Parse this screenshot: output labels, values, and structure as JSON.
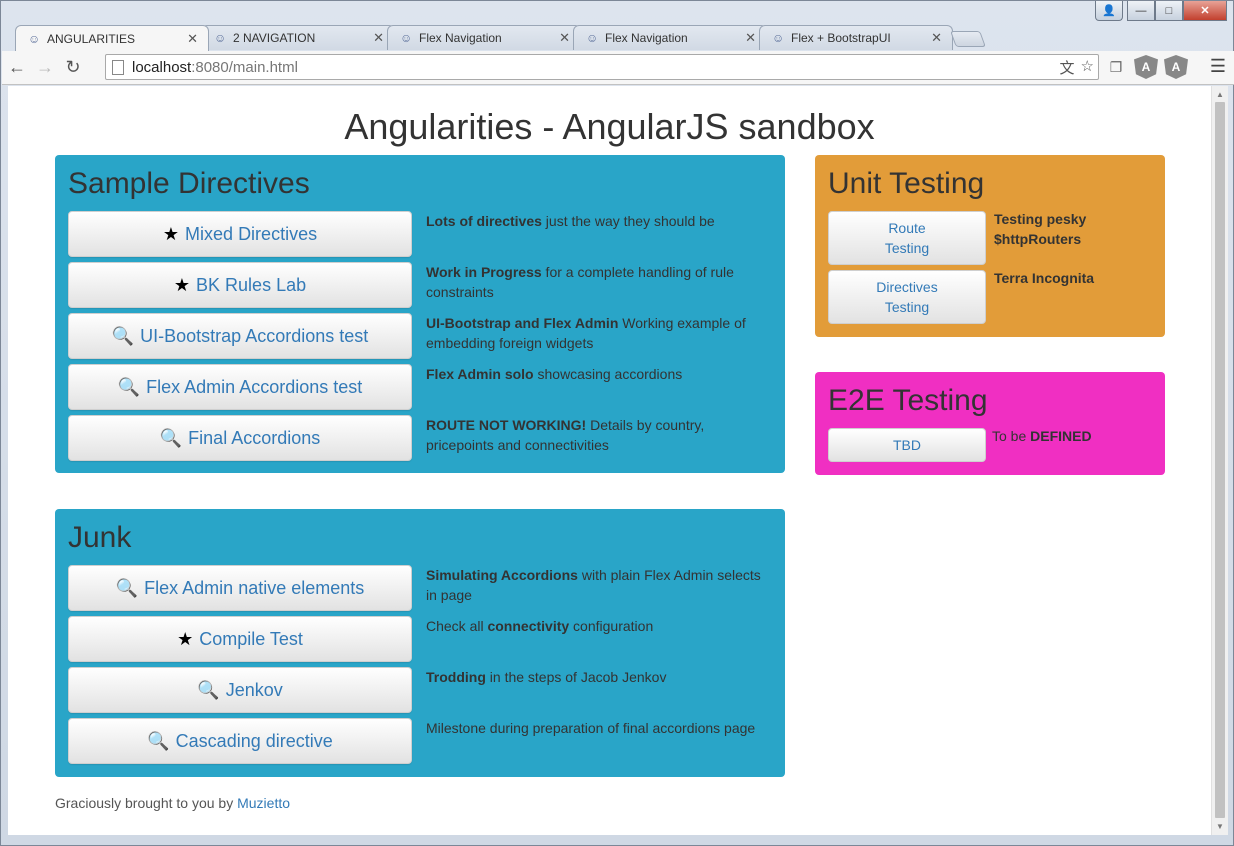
{
  "browser": {
    "tabs": [
      {
        "label": "ANGULARITIES",
        "active": true
      },
      {
        "label": "2 NAVIGATION",
        "active": false
      },
      {
        "label": "Flex Navigation",
        "active": false
      },
      {
        "label": "Flex Navigation",
        "active": false
      },
      {
        "label": "Flex + BootstrapUI",
        "active": false
      }
    ],
    "url_host": "localhost",
    "url_path": ":8080/main.html"
  },
  "page": {
    "title": "Angularities - AngularJS sandbox",
    "sample_directives": {
      "heading": "Sample Directives",
      "items": [
        {
          "icon": "star-icon",
          "label": "Mixed Directives",
          "desc_bold": "Lots of directives",
          "desc_rest": " just the way they should be"
        },
        {
          "icon": "star-icon",
          "label": "BK Rules Lab",
          "desc_bold": "Work in Progress",
          "desc_rest": " for a complete handling of rule constraints"
        },
        {
          "icon": "zoom-icon",
          "label": "UI-Bootstrap Accordions test",
          "desc_bold": "UI-Bootstrap and Flex Admin",
          "desc_rest": " Working example of embedding foreign widgets"
        },
        {
          "icon": "zoom-icon",
          "label": "Flex Admin Accordions test",
          "desc_bold": "Flex Admin solo",
          "desc_rest": " showcasing accordions"
        },
        {
          "icon": "zoom-icon",
          "label": "Final Accordions",
          "desc_bold": "ROUTE NOT WORKING!",
          "desc_rest": " Details by country, pricepoints and connectivities"
        }
      ]
    },
    "junk": {
      "heading": "Junk",
      "items": [
        {
          "icon": "zoom-icon",
          "label": "Flex Admin native elements",
          "desc_pre": "",
          "desc_bold": "Simulating Accordions",
          "desc_rest": " with plain Flex Admin selects in page"
        },
        {
          "icon": "star-icon",
          "label": "Compile Test",
          "desc_pre": "Check all ",
          "desc_bold": "connectivity",
          "desc_rest": " configuration"
        },
        {
          "icon": "zoom-icon",
          "label": "Jenkov",
          "desc_pre": "",
          "desc_bold": "Trodding",
          "desc_rest": " in the steps of Jacob Jenkov"
        },
        {
          "icon": "zoom-icon",
          "label": "Cascading directive",
          "desc_pre": "",
          "desc_bold": "",
          "desc_rest": "Milestone during preparation of final accordions page"
        }
      ]
    },
    "unit_testing": {
      "heading": "Unit Testing",
      "items": [
        {
          "line1": "Route",
          "line2": "Testing",
          "desc_line1": "Testing pesky",
          "desc_line2": "$httpRouters"
        },
        {
          "line1": "Directives",
          "line2": "Testing",
          "desc_line1": "Terra Incognita",
          "desc_line2": ""
        }
      ]
    },
    "e2e_testing": {
      "heading": "E2E Testing",
      "button": "TBD",
      "desc_pre": "To be ",
      "desc_bold": "DEFINED"
    },
    "footer": {
      "text": "Graciously brought to you by ",
      "link": "Muzietto"
    }
  },
  "colors": {
    "blue_panel": "#29a5c8",
    "orange_panel": "#e29c39",
    "pink_panel": "#f02fc2",
    "link": "#337ab7"
  }
}
